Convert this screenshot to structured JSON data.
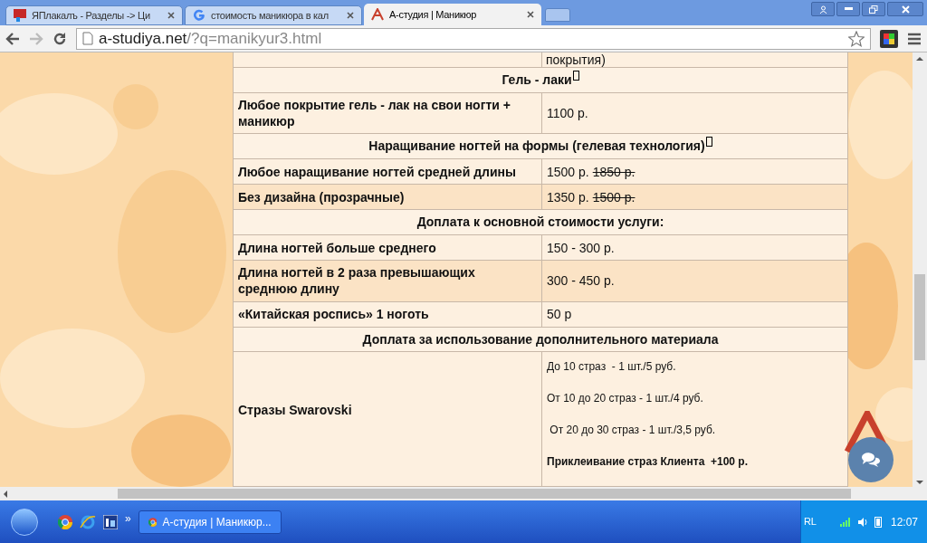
{
  "tabs": [
    {
      "kind": "yaplakal",
      "label": "ЯПлакалъ - Разделы -> Ци",
      "selected": false
    },
    {
      "kind": "google",
      "label": "стоимость маникюра в кал",
      "selected": false
    },
    {
      "kind": "astudia",
      "label": "А-студия | Маникюр",
      "selected": true
    }
  ],
  "address": {
    "host": "a-studiya.net",
    "path": "/?q=manikyur3.html"
  },
  "table": {
    "rows": [
      {
        "kind": "partial",
        "price": "покрытия)"
      },
      {
        "kind": "header",
        "title": "Гель - лаки",
        "missing_glyph": true
      },
      {
        "kind": "item",
        "name": "Любое покрытие гель - лак на свои ногти + маникюр",
        "price": "1100 р."
      },
      {
        "kind": "header",
        "title": "Наращивание ногтей на формы (гелевая технология)",
        "missing_glyph": true
      },
      {
        "kind": "item",
        "name": "Любое наращивание ногтей средней длины",
        "price": "1500 р.",
        "old_price": "1850 р."
      },
      {
        "kind": "item",
        "name": "Без дизайна (прозрачные)",
        "price": "1350 р.",
        "old_price": "1500 р."
      },
      {
        "kind": "header",
        "title": "Доплата к основной стоимости услуги:",
        "missing_glyph": false
      },
      {
        "kind": "item",
        "name": "Длина ногтей больше среднего",
        "price": "150 - 300 р."
      },
      {
        "kind": "item",
        "name": "Длина ногтей в 2 раза превышающих среднюю длину",
        "price": "300 - 450 р."
      },
      {
        "kind": "item",
        "name": "«Китайская роспись» 1 ноготь",
        "price": "50 р"
      },
      {
        "kind": "header",
        "title": "Доплата за использование дополнительного материала",
        "missing_glyph": false
      },
      {
        "kind": "lines",
        "name": "Стразы Swarovski",
        "lines": [
          {
            "text": "До 10 страз  - 1 шт./5 руб.",
            "bold": false
          },
          {
            "text": "От 10 до 20 страз - 1 шт./4 руб.",
            "bold": false
          },
          {
            "text": " От 20 до 30 страз - 1 шт./3,5 руб.",
            "bold": false
          },
          {
            "text": "Приклеивание страз Клиента  +100 р.",
            "bold": true
          }
        ]
      }
    ]
  },
  "taskbar": {
    "task": "А-студия | Маникюр...",
    "more": "»",
    "language": "RL",
    "clock": "12:07"
  }
}
